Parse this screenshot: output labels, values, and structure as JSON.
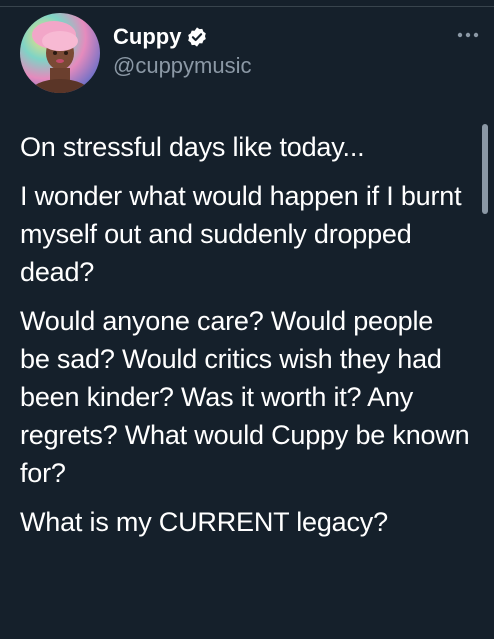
{
  "tweet": {
    "author": {
      "display_name": "Cuppy",
      "handle": "@cuppymusic",
      "verified": true
    },
    "paragraphs": [
      "On stressful days like today...",
      "I wonder what would happen if I burnt myself out and suddenly dropped dead?",
      "Would anyone care? Would people be sad? Would critics wish they had been kinder? Was it worth it? Any regrets? What would Cuppy be known for?",
      "What is my CURRENT legacy?"
    ]
  },
  "icons": {
    "verified": "verified-badge-icon",
    "more": "more-options-icon"
  },
  "colors": {
    "background": "#15202b",
    "text_primary": "#ffffff",
    "text_secondary": "#8b98a5",
    "divider": "#38444d"
  }
}
